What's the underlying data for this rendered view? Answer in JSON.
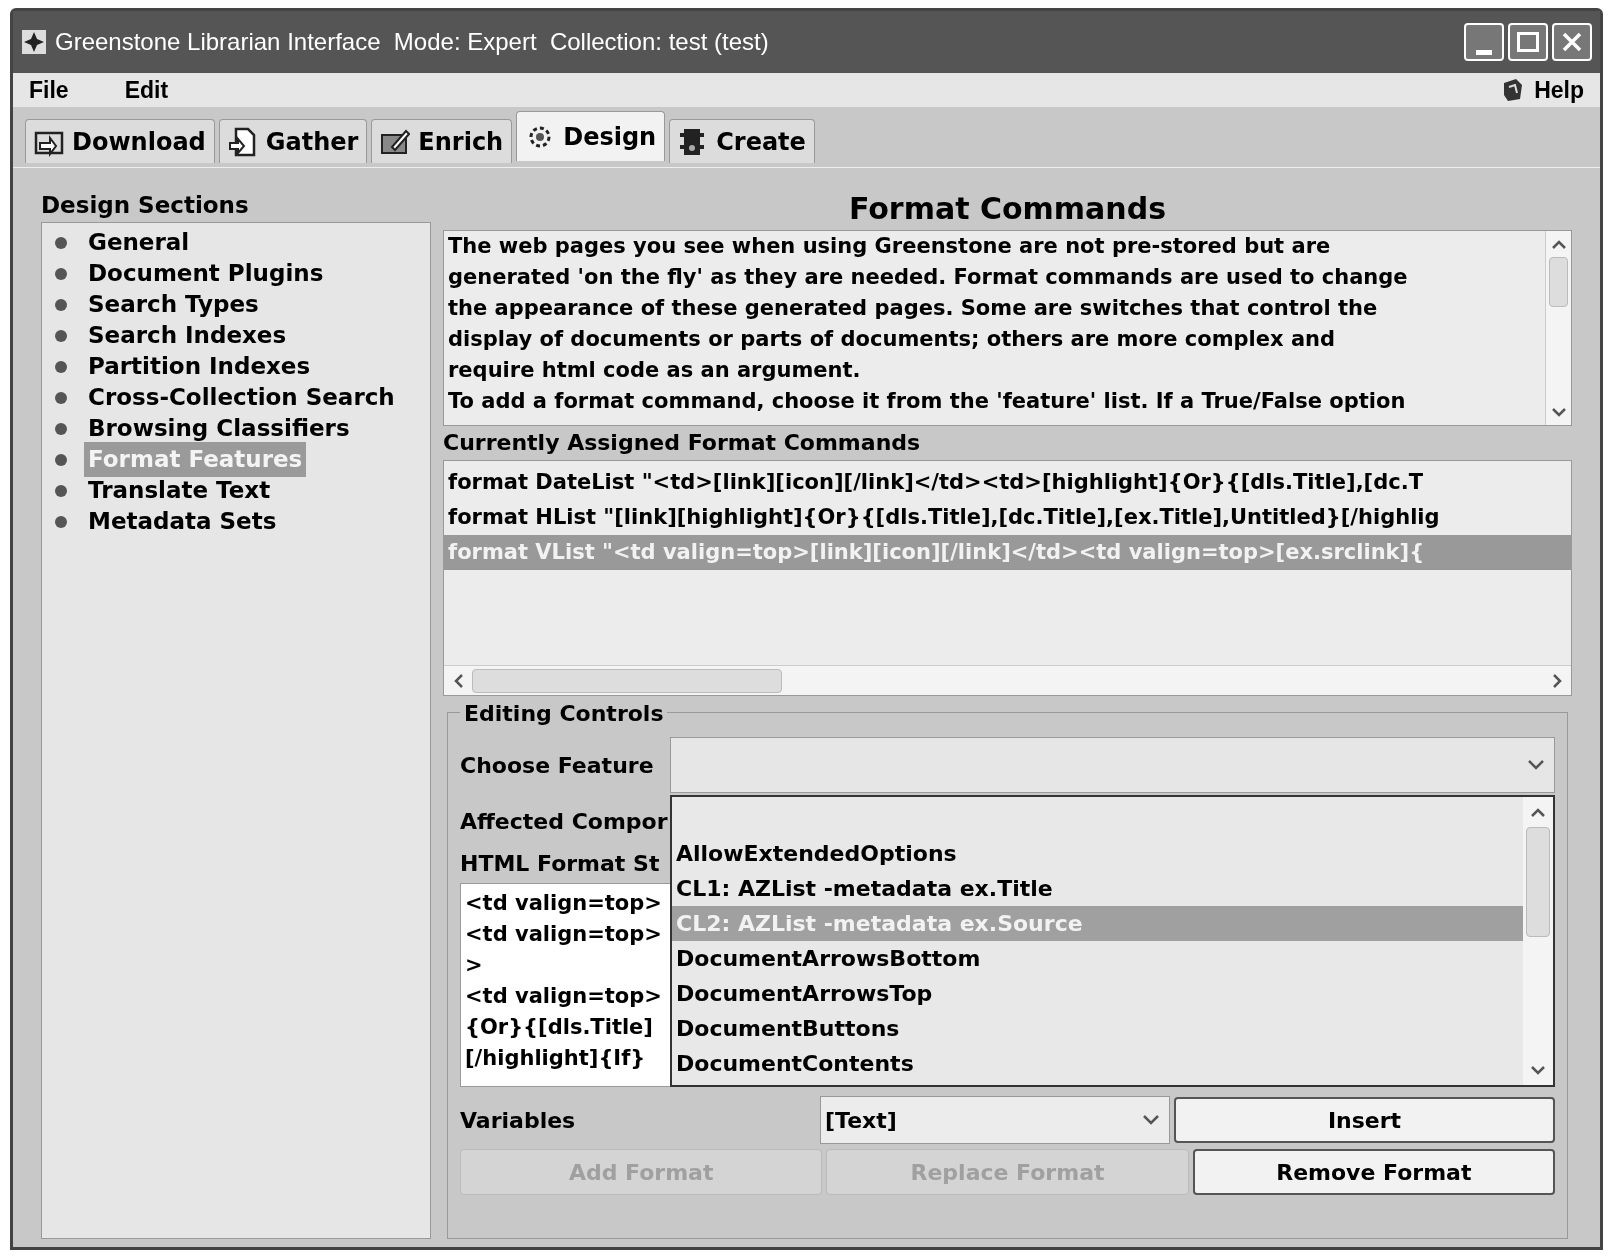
{
  "window": {
    "title": "Greenstone Librarian Interface  Mode: Expert  Collection: test (test)"
  },
  "menu": [
    "File",
    "Edit"
  ],
  "help": "Help",
  "tabs": [
    {
      "label": "Download",
      "selected": false
    },
    {
      "label": "Gather",
      "selected": false
    },
    {
      "label": "Enrich",
      "selected": false
    },
    {
      "label": "Design",
      "selected": true
    },
    {
      "label": "Create",
      "selected": false
    }
  ],
  "sidebar": {
    "title": "Design Sections",
    "items": [
      {
        "label": "General",
        "selected": false
      },
      {
        "label": "Document Plugins",
        "selected": false
      },
      {
        "label": "Search Types",
        "selected": false
      },
      {
        "label": "Search Indexes",
        "selected": false
      },
      {
        "label": "Partition Indexes",
        "selected": false
      },
      {
        "label": "Cross-Collection Search",
        "selected": false
      },
      {
        "label": "Browsing Classifiers",
        "selected": false
      },
      {
        "label": "Format Features",
        "selected": true
      },
      {
        "label": "Translate Text",
        "selected": false
      },
      {
        "label": "Metadata Sets",
        "selected": false
      }
    ]
  },
  "heading": "Format Commands",
  "description": [
    "The web pages you see when using Greenstone are not pre-stored but are",
    "generated 'on the fly' as they are needed. Format commands are used to change",
    "the appearance of these generated pages. Some are switches that control the",
    "display of documents or parts of documents; others are more complex and",
    "require html code as an argument.",
    "To add a format command, choose it from the 'feature' list. If a True/False option"
  ],
  "assigned": {
    "title": "Currently Assigned Format Commands",
    "rows": [
      {
        "text": "format DateList \"<td>[link][icon][/link]</td><td>[highlight]{Or}{[dls.Title],[dc.T",
        "selected": false
      },
      {
        "text": "format HList \"[link][highlight]{Or}{[dls.Title],[dc.Title],[ex.Title],Untitled}[/highlig",
        "selected": false
      },
      {
        "text": "format VList \"<td valign=top>[link][icon][/link]</td><td valign=top>[ex.srclink]{",
        "selected": true
      }
    ]
  },
  "editing": {
    "title": "Editing Controls",
    "choose_feature_label": "Choose Feature",
    "affected_label": "Affected Compor",
    "html_label": "HTML Format St",
    "html_lines": [
      "<td valign=top>",
      "<td valign=top>",
      ">",
      "<td valign=top>",
      "{Or}{[dls.Title]",
      "[/highlight]{If}"
    ],
    "feature_options": [
      {
        "text": "AllowExtendedOptions",
        "selected": false
      },
      {
        "text": "CL1: AZList -metadata ex.Title",
        "selected": false
      },
      {
        "text": "CL2: AZList -metadata ex.Source",
        "selected": true
      },
      {
        "text": "DocumentArrowsBottom",
        "selected": false
      },
      {
        "text": "DocumentArrowsTop",
        "selected": false
      },
      {
        "text": "DocumentButtons",
        "selected": false
      },
      {
        "text": "DocumentContents",
        "selected": false
      }
    ],
    "variables_label": "Variables",
    "variables_value": "[Text]",
    "buttons": [
      {
        "label": "Insert",
        "disabled": false
      },
      {
        "label": "Add Format",
        "disabled": true
      },
      {
        "label": "Replace Format",
        "disabled": true
      },
      {
        "label": "Remove Format",
        "disabled": false
      }
    ]
  }
}
